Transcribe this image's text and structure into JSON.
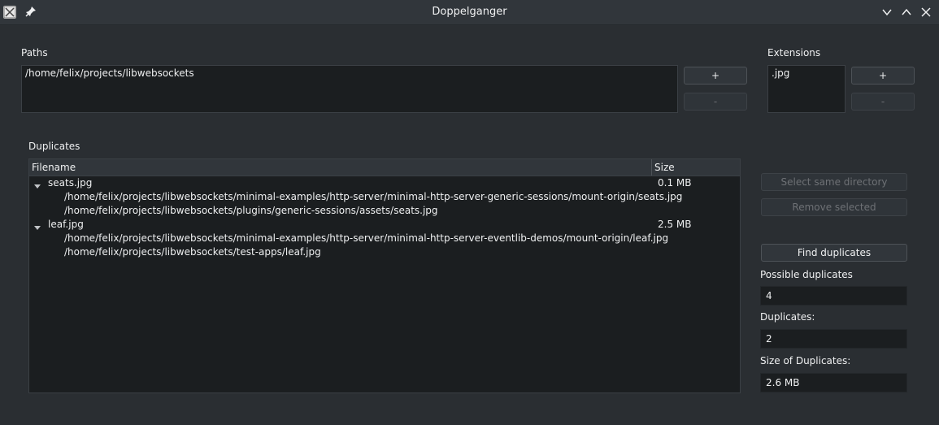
{
  "window": {
    "title": "Doppelganger"
  },
  "paths": {
    "label": "Paths",
    "items": [
      "/home/felix/projects/libwebsockets"
    ],
    "add_label": "+",
    "remove_label": "-"
  },
  "extensions": {
    "label": "Extensions",
    "items": [
      ".jpg"
    ],
    "add_label": "+",
    "remove_label": "-"
  },
  "duplicates": {
    "label": "Duplicates",
    "columns": [
      "Filename",
      "Size"
    ],
    "groups": [
      {
        "name": "seats.jpg",
        "size": "0.1 MB",
        "files": [
          "/home/felix/projects/libwebsockets/minimal-examples/http-server/minimal-http-server-generic-sessions/mount-origin/seats.jpg",
          "/home/felix/projects/libwebsockets/plugins/generic-sessions/assets/seats.jpg"
        ]
      },
      {
        "name": "leaf.jpg",
        "size": "2.5 MB",
        "files": [
          "/home/felix/projects/libwebsockets/minimal-examples/http-server/minimal-http-server-eventlib-demos/mount-origin/leaf.jpg",
          "/home/felix/projects/libwebsockets/test-apps/leaf.jpg"
        ]
      }
    ]
  },
  "actions": {
    "select_same_dir": "Select same directory",
    "remove_selected": "Remove selected",
    "find_duplicates": "Find duplicates"
  },
  "stats": {
    "possible_label": "Possible duplicates",
    "possible_value": "4",
    "duplicates_label": "Duplicates:",
    "duplicates_value": "2",
    "size_label": "Size of Duplicates:",
    "size_value": "2.6 MB"
  }
}
